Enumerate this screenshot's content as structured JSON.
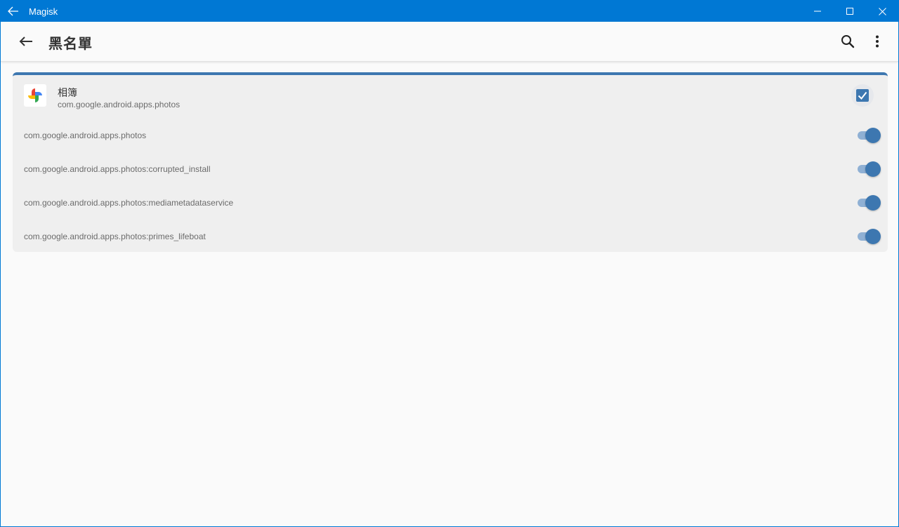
{
  "window": {
    "title": "Magisk"
  },
  "appbar": {
    "title": "黑名單"
  },
  "app": {
    "name": "相簿",
    "package": "com.google.android.apps.photos",
    "checked": true,
    "processes": [
      {
        "name": "com.google.android.apps.photos",
        "enabled": true
      },
      {
        "name": "com.google.android.apps.photos:corrupted_install",
        "enabled": true
      },
      {
        "name": "com.google.android.apps.photos:mediametadataservice",
        "enabled": true
      },
      {
        "name": "com.google.android.apps.photos:primes_lifeboat",
        "enabled": true
      }
    ]
  },
  "colors": {
    "titlebar": "#0078d4",
    "accent": "#3d77b0",
    "switch_track": "#8fb0d4",
    "card_bg": "#efefef",
    "page_bg": "#fafafa"
  },
  "icons": {
    "titlebar_back": "arrow-left-icon",
    "minimize": "minimize-icon",
    "maximize": "maximize-icon",
    "close": "close-icon",
    "appbar_back": "arrow-left-icon",
    "search": "search-icon",
    "more": "more-vert-icon",
    "app": "google-photos-icon",
    "checkbox": "check-icon"
  }
}
